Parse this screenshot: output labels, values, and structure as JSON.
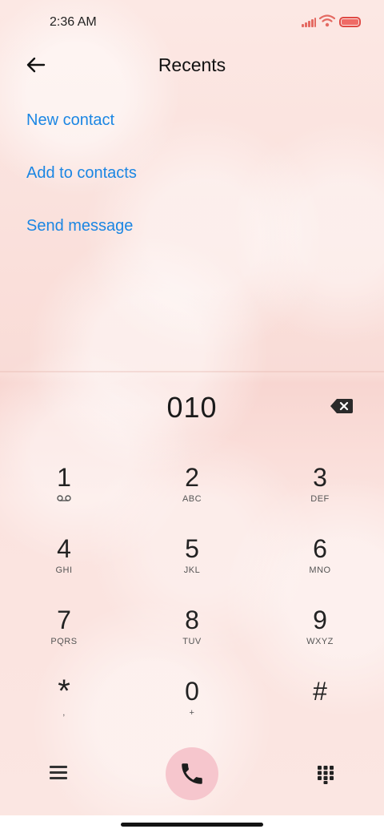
{
  "status": {
    "time": "2:36 AM"
  },
  "header": {
    "title": "Recents"
  },
  "actions": [
    "New contact",
    "Add to contacts",
    "Send message"
  ],
  "dialer": {
    "number": "010",
    "keys": [
      {
        "digit": "1",
        "letters": ""
      },
      {
        "digit": "2",
        "letters": "ABC"
      },
      {
        "digit": "3",
        "letters": "DEF"
      },
      {
        "digit": "4",
        "letters": "GHI"
      },
      {
        "digit": "5",
        "letters": "JKL"
      },
      {
        "digit": "6",
        "letters": "MNO"
      },
      {
        "digit": "7",
        "letters": "PQRS"
      },
      {
        "digit": "8",
        "letters": "TUV"
      },
      {
        "digit": "9",
        "letters": "WXYZ"
      },
      {
        "digit": "*",
        "letters": ","
      },
      {
        "digit": "0",
        "letters": "+"
      },
      {
        "digit": "#",
        "letters": ""
      }
    ]
  },
  "colors": {
    "accent": "#1b86e3",
    "call_button": "#f6c6cd",
    "battery": "#e04a45"
  },
  "icons": [
    "back-arrow-icon",
    "signal-icon",
    "wifi-icon",
    "battery-icon",
    "backspace-icon",
    "voicemail-icon",
    "menu-icon",
    "phone-icon",
    "dialpad-icon"
  ]
}
